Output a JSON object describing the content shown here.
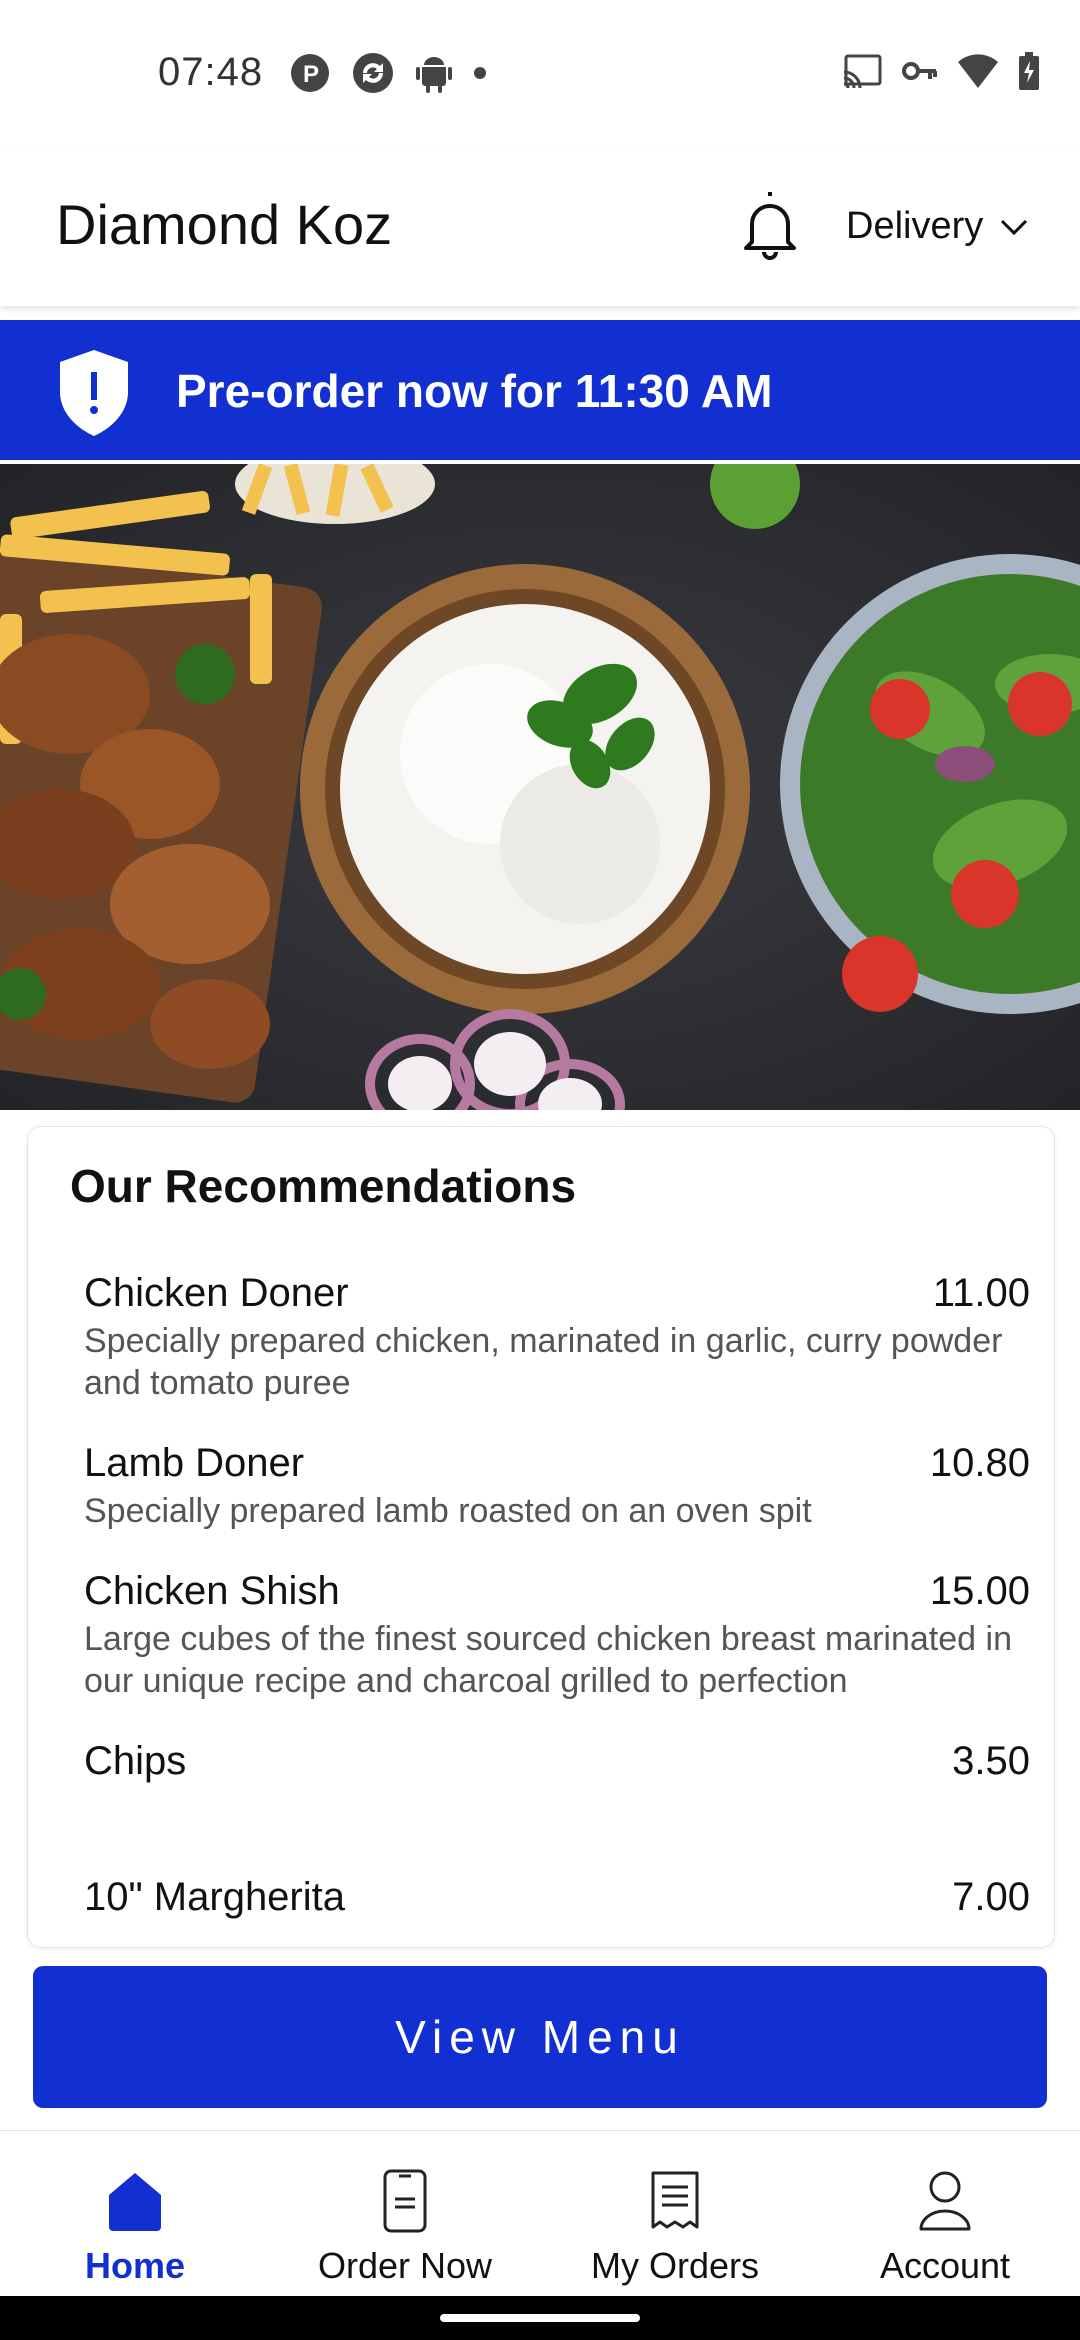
{
  "status_bar": {
    "time": "07:48",
    "left_icons": [
      "p-circle-icon",
      "sync-circle-icon",
      "android-icon",
      "dot-icon"
    ],
    "right_icons": [
      "cast-icon",
      "vpn-key-icon",
      "wifi-icon",
      "battery-charging-icon"
    ]
  },
  "header": {
    "store_name": "Diamond Koz",
    "mode": "Delivery",
    "icons": [
      "bell-icon",
      "chevron-down-icon"
    ]
  },
  "banner": {
    "text": "Pre-order now for 11:30 AM",
    "icon": "shield-alert-icon"
  },
  "recommendations": {
    "title": "Our Recommendations",
    "items": [
      {
        "name": "Chicken Doner",
        "price": "11.00",
        "description": "Specially prepared chicken, marinated in garlic, curry powder and tomato puree"
      },
      {
        "name": "Lamb Doner",
        "price": "10.80",
        "description": "Specially prepared lamb roasted on an oven spit"
      },
      {
        "name": "Chicken Shish",
        "price": "15.00",
        "description": "Large cubes of the finest sourced chicken breast marinated in our unique recipe and charcoal grilled to perfection"
      },
      {
        "name": "Chips",
        "price": "3.50",
        "description": ""
      },
      {
        "name": "10\" Margherita",
        "price": "7.00",
        "description": ""
      }
    ]
  },
  "view_menu_label": "View Menu",
  "bottom_nav": {
    "items": [
      {
        "label": "Home",
        "icon": "home-icon",
        "active": true
      },
      {
        "label": "Order Now",
        "icon": "phone-order-icon",
        "active": false
      },
      {
        "label": "My Orders",
        "icon": "receipt-icon",
        "active": false
      },
      {
        "label": "Account",
        "icon": "user-icon",
        "active": false
      }
    ]
  },
  "colors": {
    "brand_blue": "#1230d1",
    "text_dark": "#111111",
    "text_muted": "#555555"
  }
}
